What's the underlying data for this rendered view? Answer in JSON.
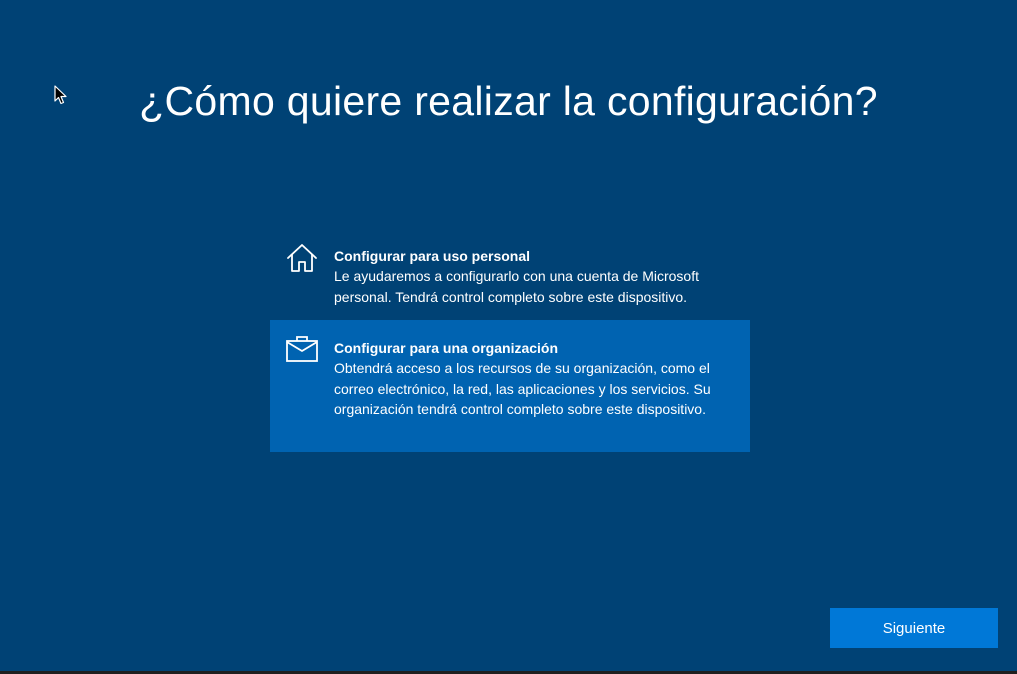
{
  "page": {
    "title": "¿Cómo quiere realizar la configuración?"
  },
  "options": [
    {
      "icon": "home-icon",
      "title": "Configurar para uso personal",
      "description": "Le ayudaremos a configurarlo con una cuenta de Microsoft personal. Tendrá control completo sobre este dispositivo.",
      "selected": false
    },
    {
      "icon": "briefcase-icon",
      "title": "Configurar para una organización",
      "description": "Obtendrá acceso a los recursos de su organización, como el correo electrónico, la red, las aplicaciones y los servicios. Su organización tendrá control completo sobre este dispositivo.",
      "selected": true
    }
  ],
  "footer": {
    "next_label": "Siguiente"
  },
  "colors": {
    "background": "#004275",
    "selected_option": "#0063b1",
    "button": "#0078d7",
    "text": "#ffffff"
  }
}
